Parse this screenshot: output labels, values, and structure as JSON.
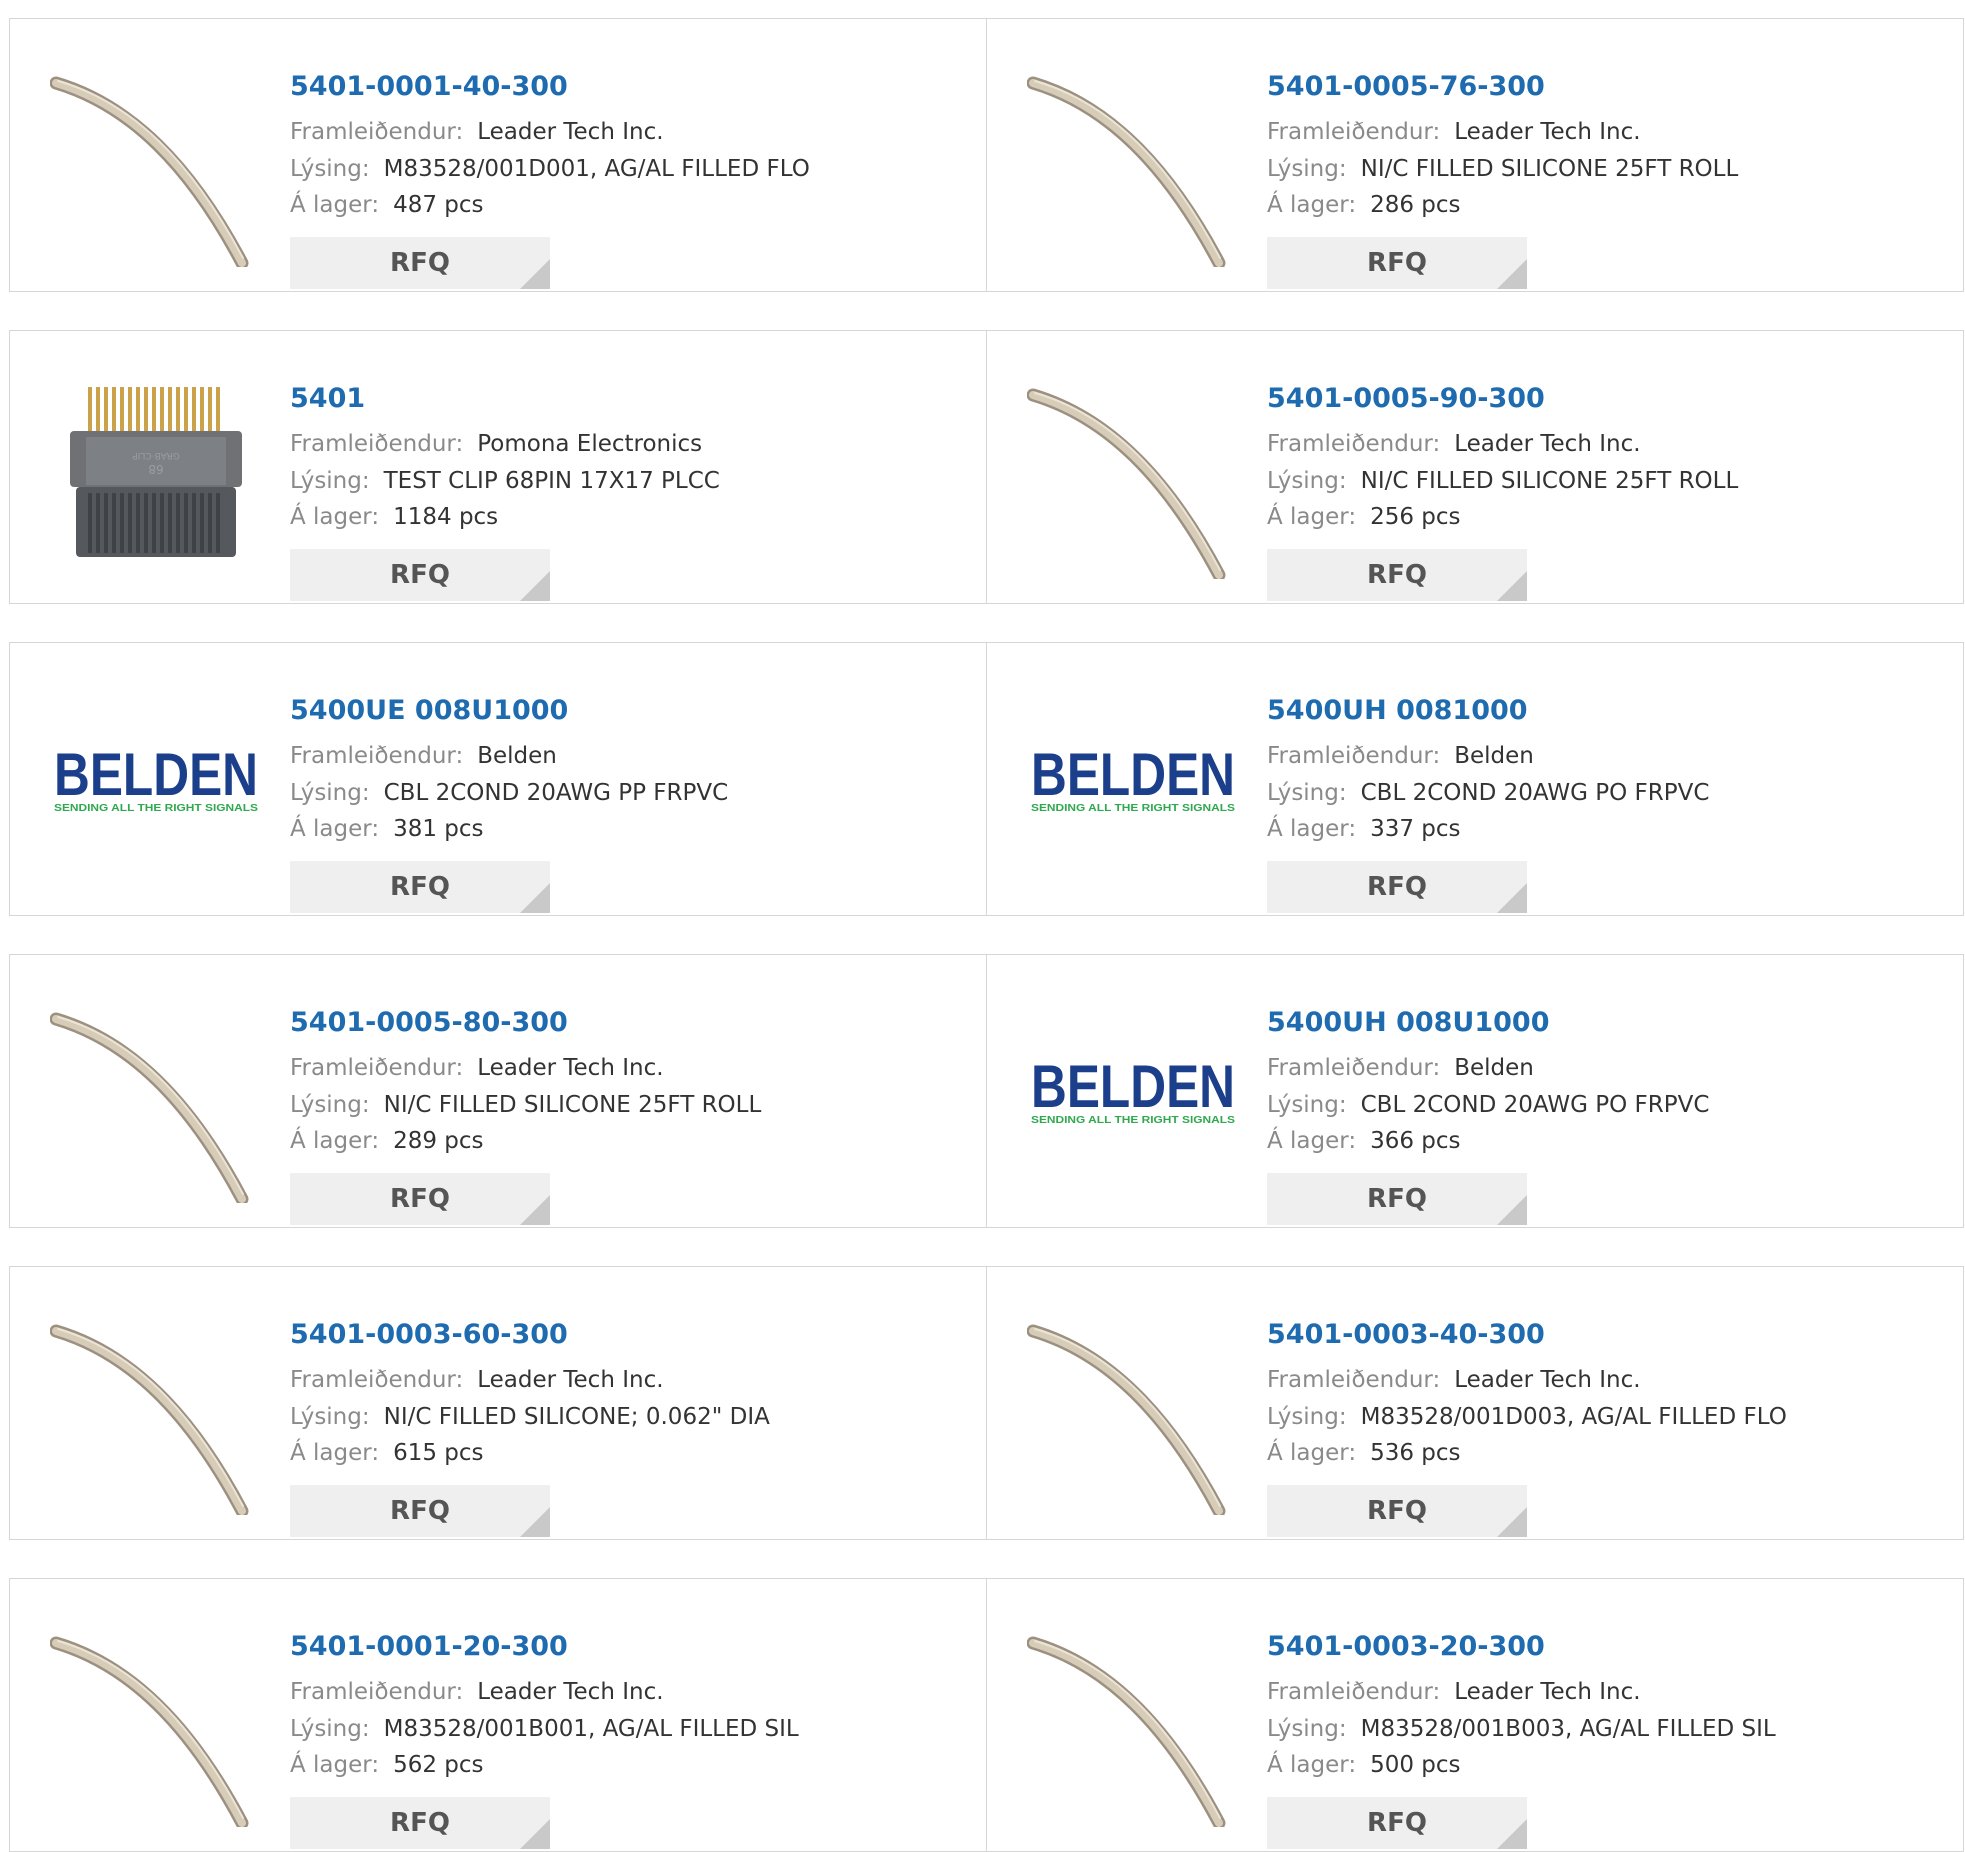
{
  "labels": {
    "manufacturer": "Framleiðendur:",
    "description": "Lýsing:",
    "stock": "Á lager:",
    "rfq": "RFQ"
  },
  "colors": {
    "link": "#1f6bb0",
    "label": "#8a8a8a",
    "button_bg": "#efefef",
    "belden_blue": "#1b3f8b",
    "belden_green": "#2fa84f"
  },
  "products": [
    {
      "part": "5401-0001-40-300",
      "manufacturer": "Leader Tech Inc.",
      "description": "M83528/001D001, AG/AL FILLED FLO",
      "stock": "487 pcs",
      "image": "gasket-cord"
    },
    {
      "part": "5401-0005-76-300",
      "manufacturer": "Leader Tech Inc.",
      "description": "NI/C FILLED SILICONE 25FT ROLL",
      "stock": "286 pcs",
      "image": "gasket-cord"
    },
    {
      "part": "5401",
      "manufacturer": "Pomona Electronics",
      "description": "TEST CLIP 68PIN 17X17 PLCC",
      "stock": "1184 pcs",
      "image": "test-clip"
    },
    {
      "part": "5401-0005-90-300",
      "manufacturer": "Leader Tech Inc.",
      "description": "NI/C FILLED SILICONE 25FT ROLL",
      "stock": "256 pcs",
      "image": "gasket-cord"
    },
    {
      "part": "5400UE 008U1000",
      "manufacturer": "Belden",
      "description": "CBL 2COND 20AWG PP FRPVC",
      "stock": "381 pcs",
      "image": "belden-logo"
    },
    {
      "part": "5400UH 0081000",
      "manufacturer": "Belden",
      "description": "CBL 2COND 20AWG PO FRPVC",
      "stock": "337 pcs",
      "image": "belden-logo"
    },
    {
      "part": "5401-0005-80-300",
      "manufacturer": "Leader Tech Inc.",
      "description": "NI/C FILLED SILICONE 25FT ROLL",
      "stock": "289 pcs",
      "image": "gasket-cord"
    },
    {
      "part": "5400UH 008U1000",
      "manufacturer": "Belden",
      "description": "CBL 2COND 20AWG PO FRPVC",
      "stock": "366 pcs",
      "image": "belden-logo"
    },
    {
      "part": "5401-0003-60-300",
      "manufacturer": "Leader Tech Inc.",
      "description": "NI/C FILLED SILICONE; 0.062\" DIA",
      "stock": "615 pcs",
      "image": "gasket-cord"
    },
    {
      "part": "5401-0003-40-300",
      "manufacturer": "Leader Tech Inc.",
      "description": "M83528/001D003, AG/AL FILLED FLO",
      "stock": "536 pcs",
      "image": "gasket-cord"
    },
    {
      "part": "5401-0001-20-300",
      "manufacturer": "Leader Tech Inc.",
      "description": "M83528/001B001, AG/AL FILLED SIL",
      "stock": "562 pcs",
      "image": "gasket-cord"
    },
    {
      "part": "5401-0003-20-300",
      "manufacturer": "Leader Tech Inc.",
      "description": "M83528/001B003, AG/AL FILLED SIL",
      "stock": "500 pcs",
      "image": "gasket-cord"
    }
  ],
  "belden_logo": {
    "word": "BELDEN",
    "tagline": "SENDING ALL THE RIGHT SIGNALS"
  },
  "test_clip_marks": {
    "brand": "GRAB·CLIP",
    "number": "68"
  }
}
